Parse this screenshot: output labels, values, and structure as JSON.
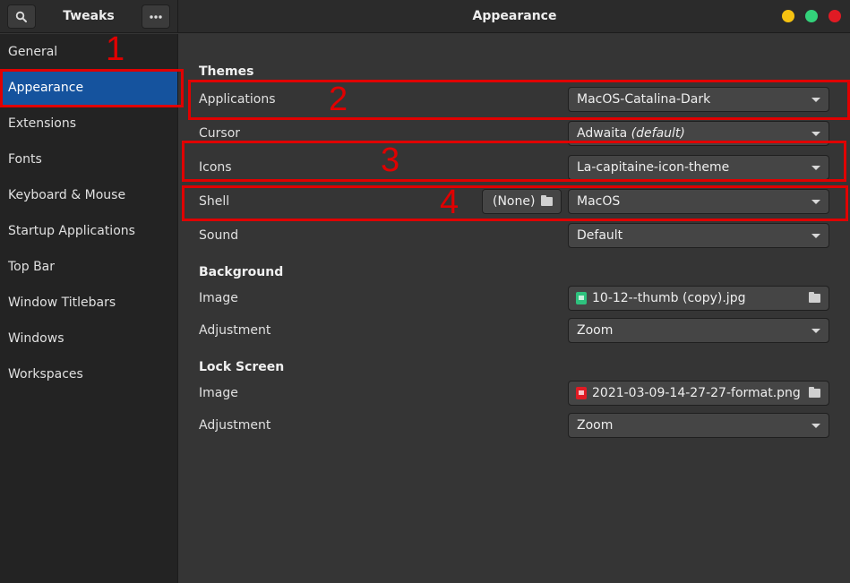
{
  "header": {
    "app_title": "Tweaks",
    "page_title": "Appearance",
    "search_icon": "search-icon",
    "menu_icon": "more-dots-icon",
    "window_controls": {
      "minimize_color": "#f5c211",
      "maximize_color": "#33d17a",
      "close_color": "#e01b24"
    }
  },
  "sidebar": {
    "items": [
      {
        "label": "General"
      },
      {
        "label": "Appearance",
        "active": true
      },
      {
        "label": "Extensions"
      },
      {
        "label": "Fonts"
      },
      {
        "label": "Keyboard & Mouse"
      },
      {
        "label": "Startup Applications"
      },
      {
        "label": "Top Bar"
      },
      {
        "label": "Window Titlebars"
      },
      {
        "label": "Windows"
      },
      {
        "label": "Workspaces"
      }
    ],
    "active_color": "#15539e"
  },
  "themes": {
    "heading": "Themes",
    "applications": {
      "label": "Applications",
      "value": "MacOS-Catalina-Dark"
    },
    "cursor": {
      "label": "Cursor",
      "value": "Adwaita",
      "value_suffix": "(default)"
    },
    "icons": {
      "label": "Icons",
      "value": "La-capitaine-icon-theme"
    },
    "shell": {
      "label": "Shell",
      "file_button": "(None)",
      "value": "MacOS"
    },
    "sound": {
      "label": "Sound",
      "value": "Default"
    }
  },
  "background": {
    "heading": "Background",
    "image": {
      "label": "Image",
      "file": "10-12--thumb (copy).jpg",
      "file_icon_color": "#2ec27e"
    },
    "adjustment": {
      "label": "Adjustment",
      "value": "Zoom"
    }
  },
  "lock_screen": {
    "heading": "Lock Screen",
    "image": {
      "label": "Image",
      "file": "2021-03-09-14-27-27-format.png",
      "file_icon_color": "#e01b24"
    },
    "adjustment": {
      "label": "Adjustment",
      "value": "Zoom"
    }
  },
  "annotations": {
    "color": "#e00000",
    "labels": [
      "1",
      "2",
      "3",
      "4"
    ]
  }
}
